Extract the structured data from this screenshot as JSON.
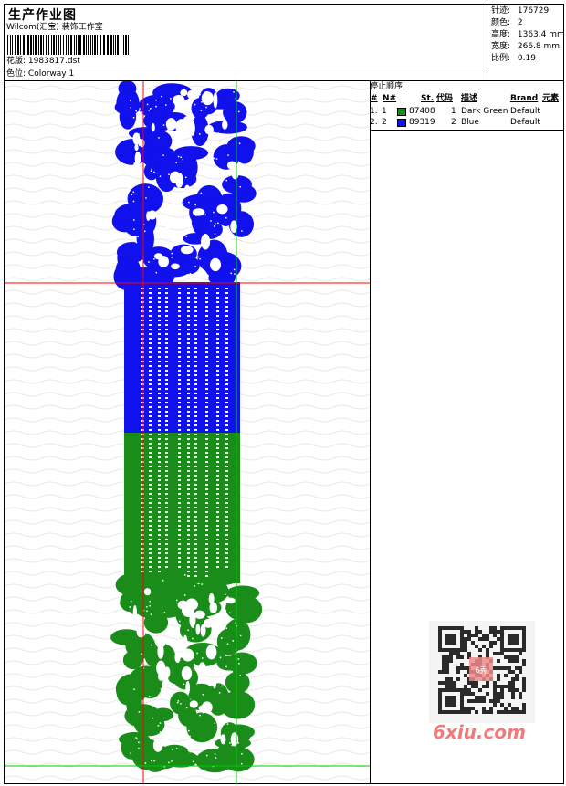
{
  "header": {
    "title": "生产作业图",
    "studio": "Wilcom(汇宝) 装饰工作室",
    "design_label": "花版:",
    "design_file": "1983817.dst",
    "colorway_label": "色位:",
    "colorway": "Colorway 1"
  },
  "stats": [
    {
      "label": "针迹:",
      "value": "176729"
    },
    {
      "label": "颜色:",
      "value": "2"
    },
    {
      "label": "高度:",
      "value": "1363.4 mm"
    },
    {
      "label": "宽度:",
      "value": "266.8 mm"
    },
    {
      "label": "比例:",
      "value": "0.19"
    }
  ],
  "stop_sequence": {
    "title": "停止顺序:",
    "columns": [
      "#",
      "N#",
      "St.",
      "代码",
      "描述",
      "Brand",
      "元素"
    ],
    "rows": [
      {
        "num": "1.",
        "n": "1",
        "color": "#1a8c1a",
        "stitches": "87408",
        "code": "1",
        "desc": "Dark Green",
        "brand": "Default"
      },
      {
        "num": "2.",
        "n": "2",
        "color": "#1111ee",
        "stitches": "89319",
        "code": "2",
        "desc": "Blue",
        "brand": "Default"
      }
    ]
  },
  "watermark": {
    "text": "6xiu.com",
    "stamp": "6秀"
  },
  "colors": {
    "blue": "#1111ee",
    "green": "#1a8c1a",
    "red_guide": "#ff0000",
    "green_guide": "#00cc00"
  }
}
